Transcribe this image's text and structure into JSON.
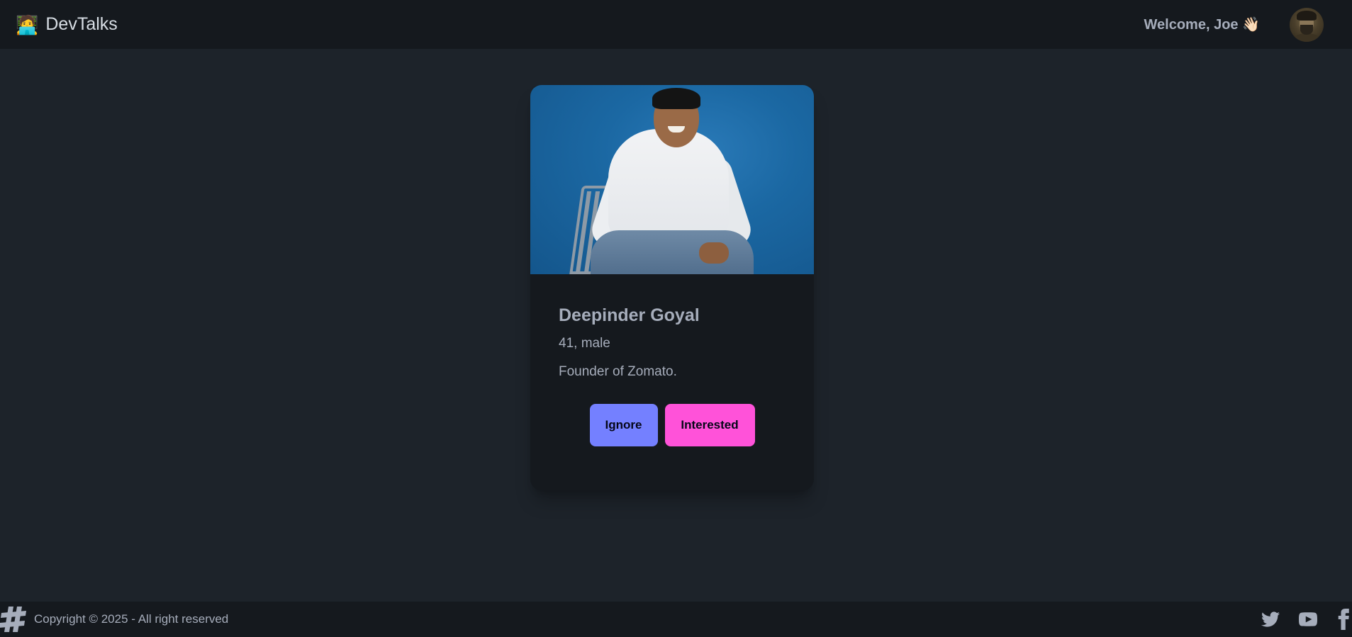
{
  "navbar": {
    "brand_icon": "🧑‍💻",
    "brand_name": "DevTalks",
    "welcome_text": "Welcome, Joe 👋🏻",
    "avatar_icon": "user-avatar"
  },
  "profile_card": {
    "photo_icon": "profile-photo",
    "name": "Deepinder Goyal",
    "age_gender": "41, male",
    "about": "Founder of Zomato.",
    "ignore_label": "Ignore",
    "interested_label": "Interested",
    "ignore_color": "#7480ff",
    "interested_color": "#ff52d9"
  },
  "footer": {
    "logo_icon": "hash-icon",
    "copyright": "Copyright © 2025 - All right reserved",
    "social_icons": [
      "twitter-icon",
      "youtube-icon",
      "facebook-icon"
    ]
  },
  "colors": {
    "page_background": "#1d232a",
    "bar_background": "#15191e",
    "text": "#a6adbb"
  }
}
